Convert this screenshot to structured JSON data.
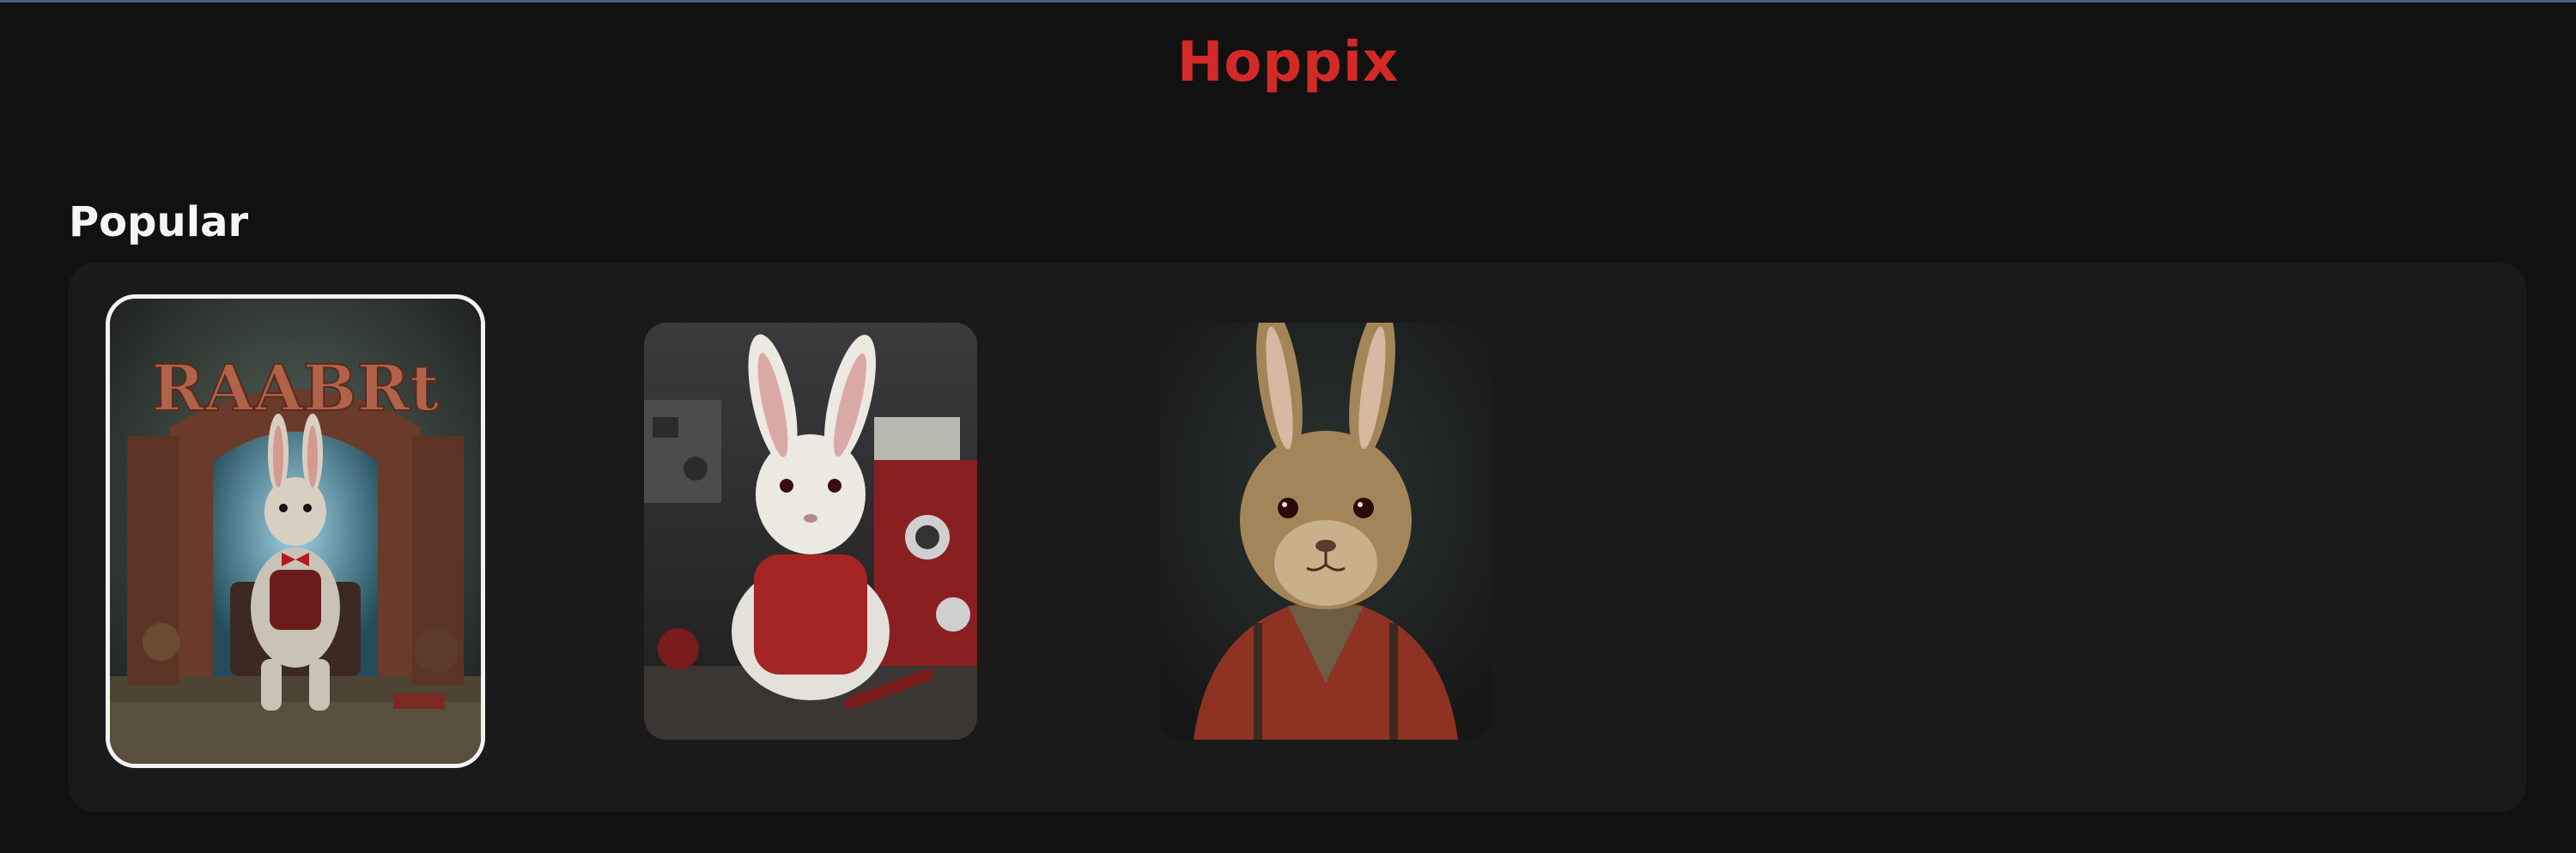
{
  "app": {
    "brand": "Hoppix",
    "brand_color": "#d42a27",
    "accent_line_color": "#4a5f86"
  },
  "popular": {
    "heading": "Popular",
    "items": [
      {
        "sign_text": "RAABRt",
        "selected": true
      },
      {
        "selected": false
      },
      {
        "selected": false
      }
    ]
  }
}
